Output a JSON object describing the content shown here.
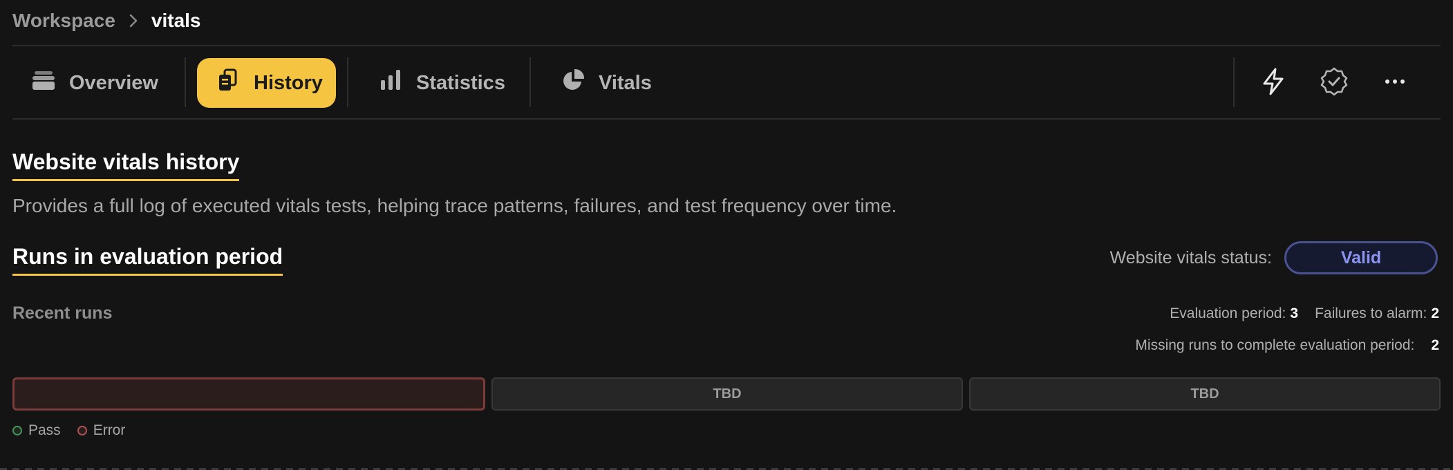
{
  "breadcrumb": {
    "root": "Workspace",
    "current": "vitals"
  },
  "tabs": [
    {
      "label": "Overview",
      "icon": "stack-icon",
      "active": false
    },
    {
      "label": "History",
      "icon": "documents-icon",
      "active": true
    },
    {
      "label": "Statistics",
      "icon": "bar-chart-icon",
      "active": false
    },
    {
      "label": "Vitals",
      "icon": "pie-chart-icon",
      "active": false
    }
  ],
  "actions": [
    {
      "name": "bolt-icon"
    },
    {
      "name": "verified-badge-icon"
    },
    {
      "name": "more-icon"
    }
  ],
  "section": {
    "title": "Website vitals history",
    "description": "Provides a full log of executed vitals tests, helping trace patterns, failures, and test frequency over time."
  },
  "evaluation": {
    "title": "Runs in evaluation period",
    "status_label": "Website vitals status:",
    "status_value": "Valid",
    "recent_label": "Recent runs",
    "period_label": "Evaluation period:",
    "period_value": "3",
    "failures_label": "Failures to alarm:",
    "failures_value": "2",
    "missing_label": "Missing runs to complete evaluation period:",
    "missing_value": "2"
  },
  "runs": [
    {
      "label": "",
      "state": "error"
    },
    {
      "label": "TBD",
      "state": "pending"
    },
    {
      "label": "TBD",
      "state": "pending"
    }
  ],
  "legend": {
    "pass": "Pass",
    "error": "Error"
  },
  "colors": {
    "accent": "#f5c542",
    "status_valid": "#8b93ee",
    "pass": "#4a8f5a",
    "error": "#a65353",
    "background": "#141414"
  }
}
